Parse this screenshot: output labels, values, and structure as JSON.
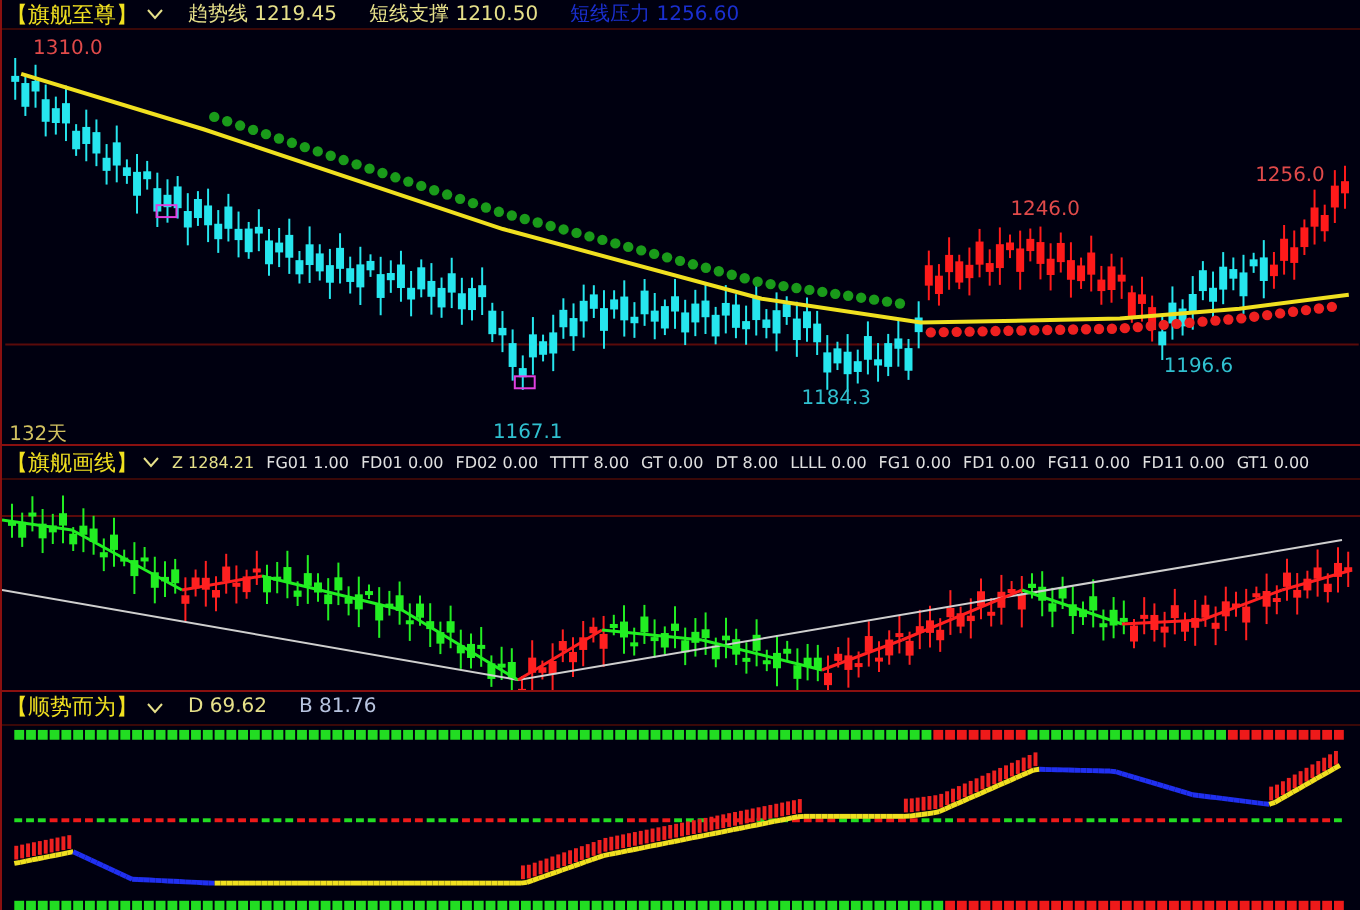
{
  "panels": [
    {
      "title": "【旗舰至尊】",
      "fields": [
        {
          "text": "趋势线 1219.45",
          "color": "#e6e08a"
        },
        {
          "text": "短线支撑 1210.50",
          "color": "#e6e08a"
        },
        {
          "text": "短线压力 1256.60",
          "color": "#1a2fd0"
        }
      ],
      "price_labels": [
        {
          "text": "1310.0",
          "kind": "high"
        },
        {
          "text": "1246.0",
          "kind": "high"
        },
        {
          "text": "1256.0",
          "kind": "high"
        },
        {
          "text": "1167.1",
          "kind": "low"
        },
        {
          "text": "1184.3",
          "kind": "low"
        },
        {
          "text": "1196.6",
          "kind": "low"
        }
      ],
      "period": "132天"
    },
    {
      "title": "【旗舰画线】",
      "fields": [
        {
          "text": "Z 1284.21",
          "color": "#e6e08a"
        },
        {
          "text": "FG01 1.00",
          "color": "#e0e0e0"
        },
        {
          "text": "FD01 0.00",
          "color": "#e0e0e0"
        },
        {
          "text": "FD02 0.00",
          "color": "#e0e0e0"
        },
        {
          "text": "TTTT 8.00",
          "color": "#e0e0e0"
        },
        {
          "text": "GT 0.00",
          "color": "#e0e0e0"
        },
        {
          "text": "DT 8.00",
          "color": "#e0e0e0"
        },
        {
          "text": "LLLL 0.00",
          "color": "#e0e0e0"
        },
        {
          "text": "FG1 0.00",
          "color": "#e0e0e0"
        },
        {
          "text": "FD1 0.00",
          "color": "#e0e0e0"
        },
        {
          "text": "FG11 0.00",
          "color": "#e0e0e0"
        },
        {
          "text": "FD11 0.00",
          "color": "#e0e0e0"
        },
        {
          "text": "GT1 0.00",
          "color": "#e0e0e0"
        }
      ]
    },
    {
      "title": "【顺势而为】",
      "fields": [
        {
          "text": "D 69.62",
          "color": "#e6e08a"
        },
        {
          "text": "B 81.76",
          "color": "#b8c4e0"
        }
      ]
    }
  ]
}
